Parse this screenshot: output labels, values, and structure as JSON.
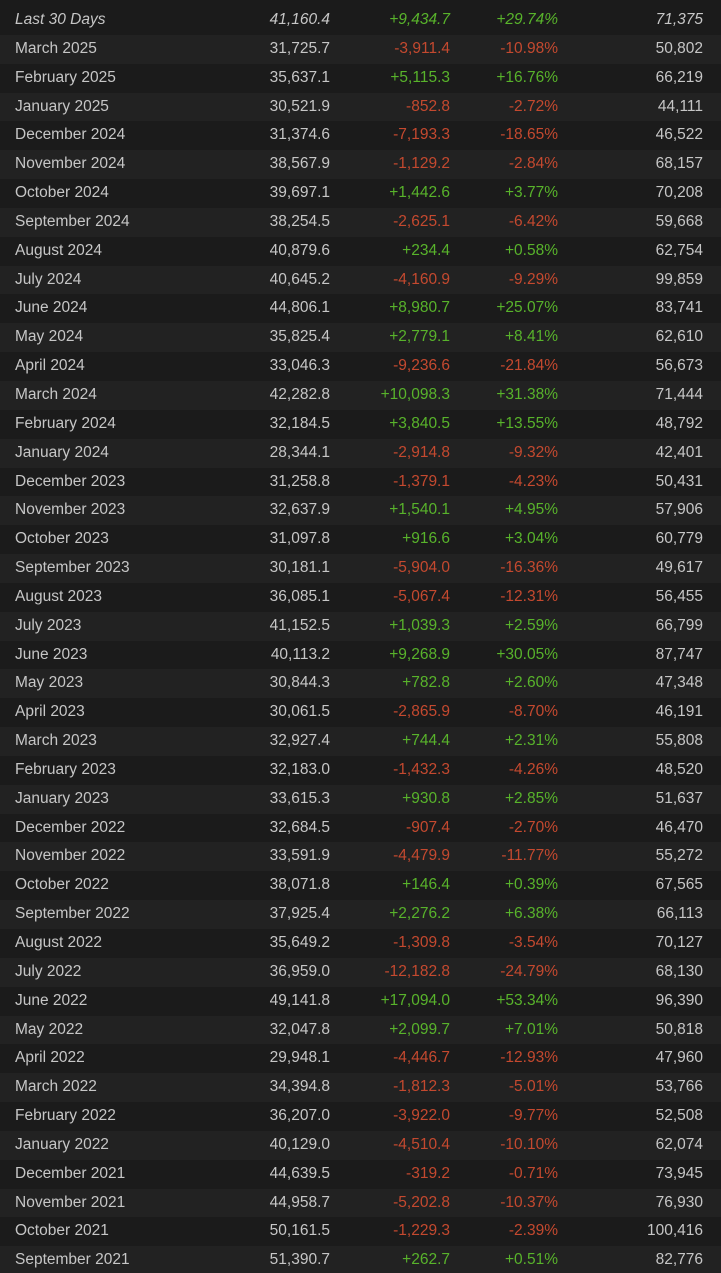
{
  "colors": {
    "background": "#1b1b1b",
    "row_alt": "#222222",
    "text": "#c6c6c6",
    "positive": "#58b32b",
    "negative": "#c4492f"
  },
  "rows": [
    {
      "month": "Last 30 Days",
      "avg": "41,160.4",
      "gain": "+9,434.7",
      "pct": "+29.74%",
      "peak": "71,375"
    },
    {
      "month": "March 2025",
      "avg": "31,725.7",
      "gain": "-3,911.4",
      "pct": "-10.98%",
      "peak": "50,802"
    },
    {
      "month": "February 2025",
      "avg": "35,637.1",
      "gain": "+5,115.3",
      "pct": "+16.76%",
      "peak": "66,219"
    },
    {
      "month": "January 2025",
      "avg": "30,521.9",
      "gain": "-852.8",
      "pct": "-2.72%",
      "peak": "44,111"
    },
    {
      "month": "December 2024",
      "avg": "31,374.6",
      "gain": "-7,193.3",
      "pct": "-18.65%",
      "peak": "46,522"
    },
    {
      "month": "November 2024",
      "avg": "38,567.9",
      "gain": "-1,129.2",
      "pct": "-2.84%",
      "peak": "68,157"
    },
    {
      "month": "October 2024",
      "avg": "39,697.1",
      "gain": "+1,442.6",
      "pct": "+3.77%",
      "peak": "70,208"
    },
    {
      "month": "September 2024",
      "avg": "38,254.5",
      "gain": "-2,625.1",
      "pct": "-6.42%",
      "peak": "59,668"
    },
    {
      "month": "August 2024",
      "avg": "40,879.6",
      "gain": "+234.4",
      "pct": "+0.58%",
      "peak": "62,754"
    },
    {
      "month": "July 2024",
      "avg": "40,645.2",
      "gain": "-4,160.9",
      "pct": "-9.29%",
      "peak": "99,859"
    },
    {
      "month": "June 2024",
      "avg": "44,806.1",
      "gain": "+8,980.7",
      "pct": "+25.07%",
      "peak": "83,741"
    },
    {
      "month": "May 2024",
      "avg": "35,825.4",
      "gain": "+2,779.1",
      "pct": "+8.41%",
      "peak": "62,610"
    },
    {
      "month": "April 2024",
      "avg": "33,046.3",
      "gain": "-9,236.6",
      "pct": "-21.84%",
      "peak": "56,673"
    },
    {
      "month": "March 2024",
      "avg": "42,282.8",
      "gain": "+10,098.3",
      "pct": "+31.38%",
      "peak": "71,444"
    },
    {
      "month": "February 2024",
      "avg": "32,184.5",
      "gain": "+3,840.5",
      "pct": "+13.55%",
      "peak": "48,792"
    },
    {
      "month": "January 2024",
      "avg": "28,344.1",
      "gain": "-2,914.8",
      "pct": "-9.32%",
      "peak": "42,401"
    },
    {
      "month": "December 2023",
      "avg": "31,258.8",
      "gain": "-1,379.1",
      "pct": "-4.23%",
      "peak": "50,431"
    },
    {
      "month": "November 2023",
      "avg": "32,637.9",
      "gain": "+1,540.1",
      "pct": "+4.95%",
      "peak": "57,906"
    },
    {
      "month": "October 2023",
      "avg": "31,097.8",
      "gain": "+916.6",
      "pct": "+3.04%",
      "peak": "60,779"
    },
    {
      "month": "September 2023",
      "avg": "30,181.1",
      "gain": "-5,904.0",
      "pct": "-16.36%",
      "peak": "49,617"
    },
    {
      "month": "August 2023",
      "avg": "36,085.1",
      "gain": "-5,067.4",
      "pct": "-12.31%",
      "peak": "56,455"
    },
    {
      "month": "July 2023",
      "avg": "41,152.5",
      "gain": "+1,039.3",
      "pct": "+2.59%",
      "peak": "66,799"
    },
    {
      "month": "June 2023",
      "avg": "40,113.2",
      "gain": "+9,268.9",
      "pct": "+30.05%",
      "peak": "87,747"
    },
    {
      "month": "May 2023",
      "avg": "30,844.3",
      "gain": "+782.8",
      "pct": "+2.60%",
      "peak": "47,348"
    },
    {
      "month": "April 2023",
      "avg": "30,061.5",
      "gain": "-2,865.9",
      "pct": "-8.70%",
      "peak": "46,191"
    },
    {
      "month": "March 2023",
      "avg": "32,927.4",
      "gain": "+744.4",
      "pct": "+2.31%",
      "peak": "55,808"
    },
    {
      "month": "February 2023",
      "avg": "32,183.0",
      "gain": "-1,432.3",
      "pct": "-4.26%",
      "peak": "48,520"
    },
    {
      "month": "January 2023",
      "avg": "33,615.3",
      "gain": "+930.8",
      "pct": "+2.85%",
      "peak": "51,637"
    },
    {
      "month": "December 2022",
      "avg": "32,684.5",
      "gain": "-907.4",
      "pct": "-2.70%",
      "peak": "46,470"
    },
    {
      "month": "November 2022",
      "avg": "33,591.9",
      "gain": "-4,479.9",
      "pct": "-11.77%",
      "peak": "55,272"
    },
    {
      "month": "October 2022",
      "avg": "38,071.8",
      "gain": "+146.4",
      "pct": "+0.39%",
      "peak": "67,565"
    },
    {
      "month": "September 2022",
      "avg": "37,925.4",
      "gain": "+2,276.2",
      "pct": "+6.38%",
      "peak": "66,113"
    },
    {
      "month": "August 2022",
      "avg": "35,649.2",
      "gain": "-1,309.8",
      "pct": "-3.54%",
      "peak": "70,127"
    },
    {
      "month": "July 2022",
      "avg": "36,959.0",
      "gain": "-12,182.8",
      "pct": "-24.79%",
      "peak": "68,130"
    },
    {
      "month": "June 2022",
      "avg": "49,141.8",
      "gain": "+17,094.0",
      "pct": "+53.34%",
      "peak": "96,390"
    },
    {
      "month": "May 2022",
      "avg": "32,047.8",
      "gain": "+2,099.7",
      "pct": "+7.01%",
      "peak": "50,818"
    },
    {
      "month": "April 2022",
      "avg": "29,948.1",
      "gain": "-4,446.7",
      "pct": "-12.93%",
      "peak": "47,960"
    },
    {
      "month": "March 2022",
      "avg": "34,394.8",
      "gain": "-1,812.3",
      "pct": "-5.01%",
      "peak": "53,766"
    },
    {
      "month": "February 2022",
      "avg": "36,207.0",
      "gain": "-3,922.0",
      "pct": "-9.77%",
      "peak": "52,508"
    },
    {
      "month": "January 2022",
      "avg": "40,129.0",
      "gain": "-4,510.4",
      "pct": "-10.10%",
      "peak": "62,074"
    },
    {
      "month": "December 2021",
      "avg": "44,639.5",
      "gain": "-319.2",
      "pct": "-0.71%",
      "peak": "73,945"
    },
    {
      "month": "November 2021",
      "avg": "44,958.7",
      "gain": "-5,202.8",
      "pct": "-10.37%",
      "peak": "76,930"
    },
    {
      "month": "October 2021",
      "avg": "50,161.5",
      "gain": "-1,229.3",
      "pct": "-2.39%",
      "peak": "100,416"
    },
    {
      "month": "September 2021",
      "avg": "51,390.7",
      "gain": "+262.7",
      "pct": "+0.51%",
      "peak": "82,776"
    }
  ]
}
